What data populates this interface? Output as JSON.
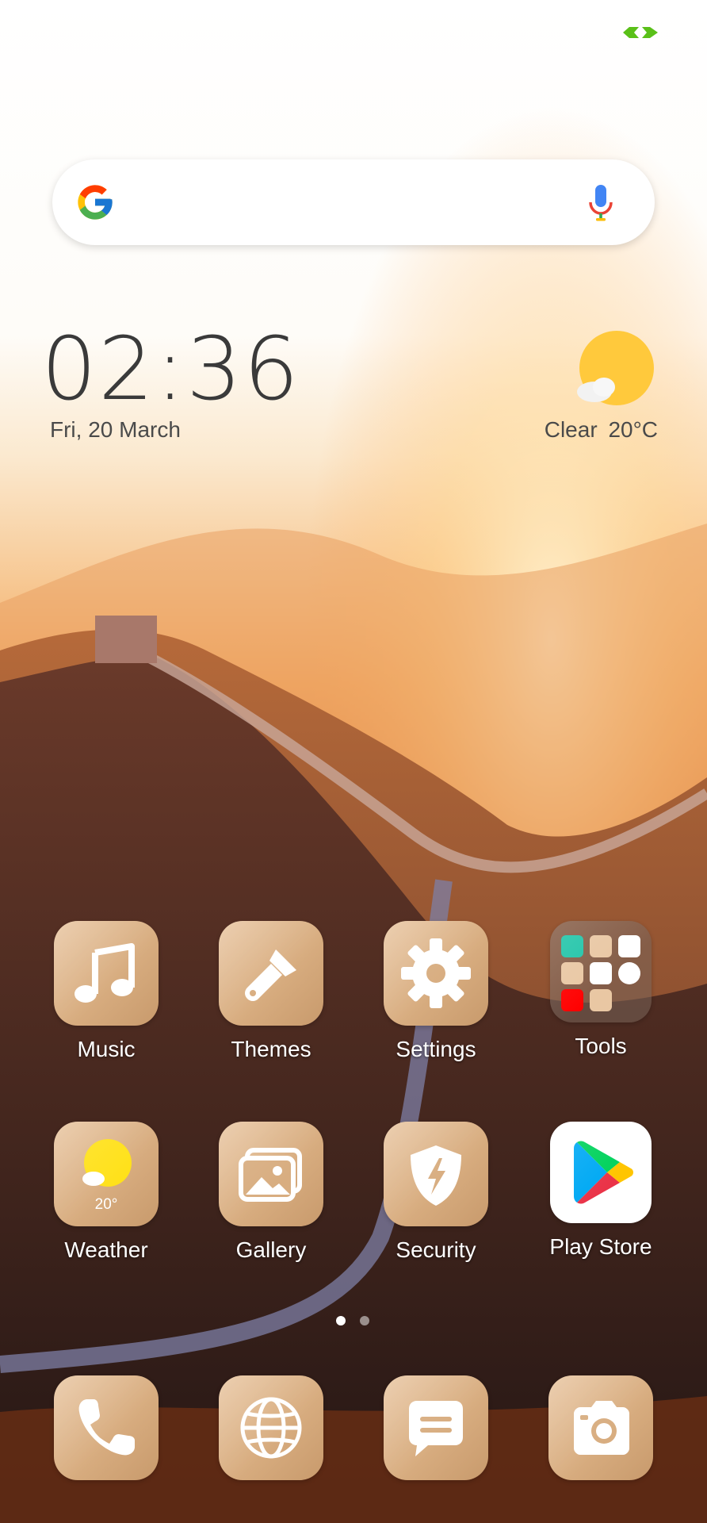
{
  "status": {
    "battery_icon": "battery-charging-icon"
  },
  "search": {
    "logo_icon": "google-logo-icon",
    "mic_icon": "microphone-icon"
  },
  "clock_widget": {
    "time": "02:36",
    "date": "Fri, 20 March"
  },
  "weather_widget": {
    "condition": "Clear",
    "temperature": "20°C",
    "icon": "sun-cloud-icon"
  },
  "apps": {
    "row1": [
      {
        "label": "Music",
        "icon": "music-note-icon"
      },
      {
        "label": "Themes",
        "icon": "paintbrush-icon"
      },
      {
        "label": "Settings",
        "icon": "gear-icon"
      },
      {
        "label": "Tools",
        "icon": "folder-icon"
      }
    ],
    "row2": [
      {
        "label": "Weather",
        "icon": "sun-cloud-icon",
        "temp": "20°"
      },
      {
        "label": "Gallery",
        "icon": "photos-icon"
      },
      {
        "label": "Security",
        "icon": "shield-bolt-icon"
      },
      {
        "label": "Play Store",
        "icon": "play-store-icon"
      }
    ]
  },
  "pager": {
    "pages": 2,
    "current": 1
  },
  "dock": [
    {
      "icon": "phone-icon"
    },
    {
      "icon": "globe-icon"
    },
    {
      "icon": "message-icon"
    },
    {
      "icon": "camera-icon"
    }
  ],
  "colors": {
    "tile": "#d8ad80",
    "clock_text": "#3a3a3a",
    "battery": "#5ac018"
  }
}
